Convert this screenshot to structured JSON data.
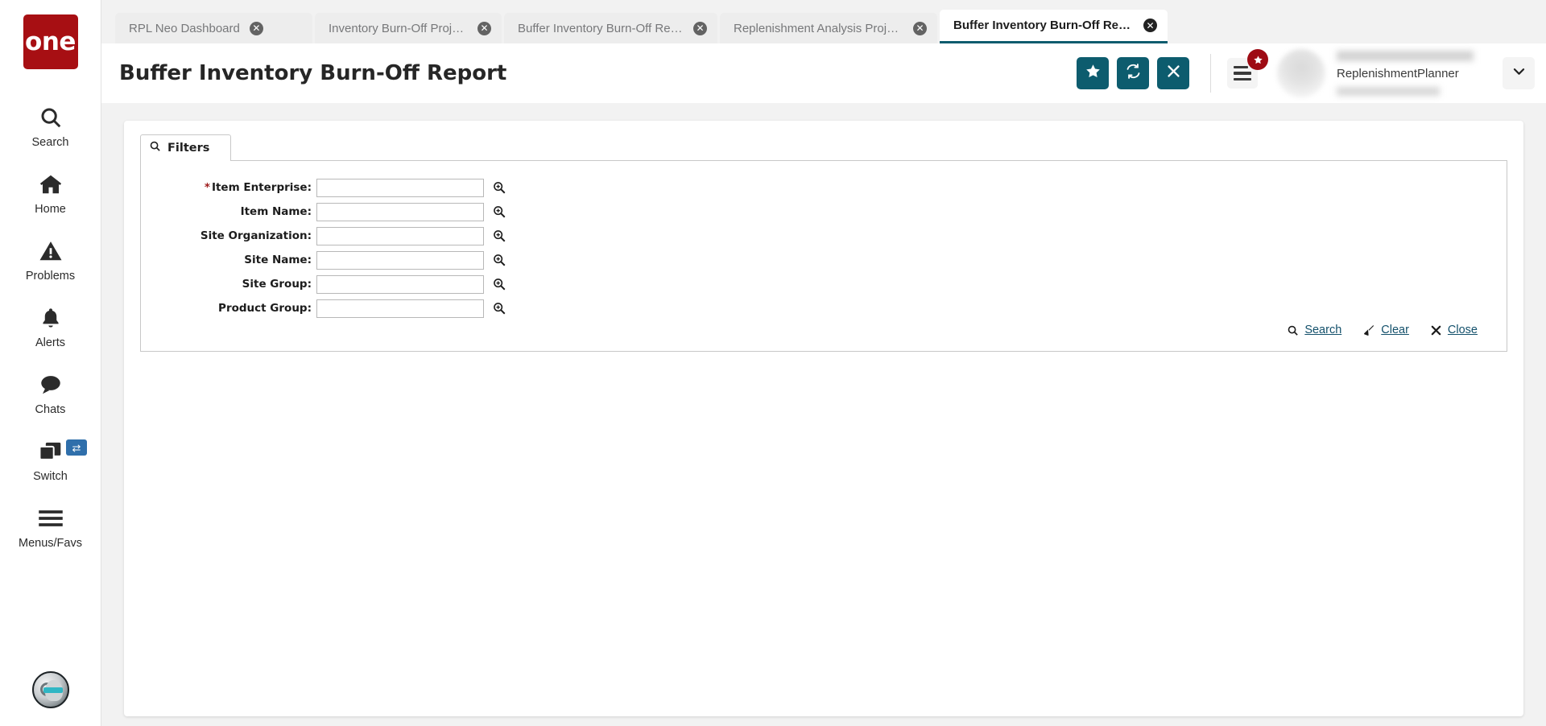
{
  "brand": {
    "logo_text": "one",
    "logo_color": "#a70f13"
  },
  "rail": {
    "items": [
      {
        "label": "Search",
        "icon": "search-icon"
      },
      {
        "label": "Home",
        "icon": "home-icon"
      },
      {
        "label": "Problems",
        "icon": "warning-triangle-icon"
      },
      {
        "label": "Alerts",
        "icon": "bell-icon"
      },
      {
        "label": "Chats",
        "icon": "chat-bubble-icon"
      },
      {
        "label": "Switch",
        "icon": "windows-stack-icon",
        "badge_icon": "swap-arrows-icon"
      },
      {
        "label": "Menus/Favs",
        "icon": "hamburger-icon"
      }
    ],
    "bottom_avatar_icon": "ai-assistant-avatar-icon"
  },
  "tabs": [
    {
      "label": "RPL Neo Dashboard",
      "active": false
    },
    {
      "label": "Inventory Burn-Off Projected Inv...",
      "active": false
    },
    {
      "label": "Buffer Inventory Burn-Off Report",
      "active": false
    },
    {
      "label": "Replenishment Analysis Projecte...",
      "active": false
    },
    {
      "label": "Buffer Inventory Burn-Off Report",
      "active": true
    }
  ],
  "header": {
    "title": "Buffer Inventory Burn-Off Report",
    "accent_color": "#0d5c6e",
    "buttons": [
      {
        "name": "favorite-button",
        "icon": "star-icon"
      },
      {
        "name": "refresh-button",
        "icon": "refresh-icon"
      },
      {
        "name": "close-button",
        "icon": "x-icon"
      }
    ],
    "menu_button": {
      "icon": "hamburger-icon",
      "badge_icon": "star-icon",
      "badge_color": "#9e0b14"
    },
    "user": {
      "role": "ReplenishmentPlanner",
      "caret_icon": "chevron-down-icon"
    }
  },
  "filters": {
    "tab_label": "Filters",
    "tab_icon": "search-icon",
    "fields": [
      {
        "label": "Item Enterprise:",
        "required": true,
        "value": "",
        "placeholder": "",
        "lookup_icon": "lookup-zoom-in-icon"
      },
      {
        "label": "Item Name:",
        "required": false,
        "value": "",
        "placeholder": "",
        "lookup_icon": "lookup-zoom-in-icon"
      },
      {
        "label": "Site Organization:",
        "required": false,
        "value": "",
        "placeholder": "",
        "lookup_icon": "lookup-zoom-in-icon"
      },
      {
        "label": "Site Name:",
        "required": false,
        "value": "",
        "placeholder": "",
        "lookup_icon": "lookup-zoom-in-icon"
      },
      {
        "label": "Site Group:",
        "required": false,
        "value": "",
        "placeholder": "",
        "lookup_icon": "lookup-zoom-in-icon"
      },
      {
        "label": "Product Group:",
        "required": false,
        "value": "",
        "placeholder": "",
        "lookup_icon": "lookup-zoom-in-icon"
      }
    ],
    "actions": [
      {
        "label": "Search",
        "icon": "search-icon"
      },
      {
        "label": "Clear",
        "icon": "broom-icon"
      },
      {
        "label": "Close",
        "icon": "x-icon"
      }
    ]
  }
}
